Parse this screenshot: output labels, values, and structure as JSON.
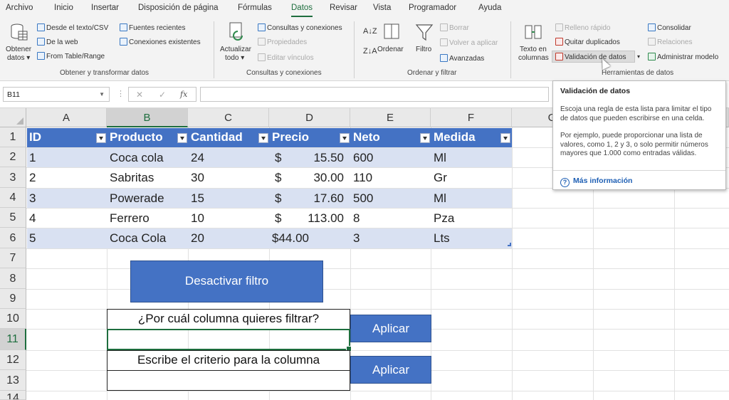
{
  "ribbon_tabs": [
    "Archivo",
    "Inicio",
    "Insertar",
    "Disposición de página",
    "Fórmulas",
    "Datos",
    "Revisar",
    "Vista",
    "Programador",
    "Ayuda"
  ],
  "active_tab": "Datos",
  "groups": {
    "obtener": {
      "label": "Obtener y transformar datos",
      "big_button_line1": "Obtener",
      "big_button_line2": "datos ▾",
      "items": [
        "Desde el texto/CSV",
        "De la web",
        "From Table/Range",
        "Fuentes recientes",
        "Conexiones existentes"
      ]
    },
    "consultas": {
      "label": "Consultas y conexiones",
      "big_button_line1": "Actualizar",
      "big_button_line2": "todo ▾",
      "items": [
        "Consultas y conexiones",
        "Propiedades",
        "Editar vínculos"
      ]
    },
    "ordenar": {
      "label": "Ordenar y filtrar",
      "sort_az": "A↓Z",
      "sort_za": "Z↓A",
      "ordenar": "Ordenar",
      "filtro": "Filtro",
      "borrar": "Borrar",
      "volver": "Volver a aplicar",
      "avanzadas": "Avanzadas"
    },
    "herramientas": {
      "label": "Herramientas de datos",
      "texto_line1": "Texto en",
      "texto_line2": "columnas",
      "items": [
        "Relleno rápido",
        "Quitar duplicados",
        "Validación de datos",
        "Consolidar",
        "Relaciones",
        "Administrar modelo"
      ]
    }
  },
  "formula_bar": {
    "name_box": "B11",
    "cancel": "✕",
    "enter": "✓",
    "fx": "fx",
    "value": ""
  },
  "columns": [
    "A",
    "B",
    "C",
    "D",
    "E",
    "F",
    "G"
  ],
  "rows": [
    "1",
    "2",
    "3",
    "4",
    "5",
    "6",
    "7",
    "8",
    "9",
    "10",
    "11",
    "12",
    "13",
    "14"
  ],
  "table": {
    "headers": [
      "ID",
      "Producto",
      "Cantidad",
      "Precio",
      "Neto",
      "Medida"
    ],
    "rows": [
      [
        "1",
        "Coca cola",
        "24",
        "$",
        "15.50",
        "600",
        "Ml"
      ],
      [
        "2",
        "Sabritas",
        "30",
        "$",
        "30.00",
        "110",
        "Gr"
      ],
      [
        "3",
        "Powerade",
        "15",
        "$",
        "17.60",
        "500",
        "Ml"
      ],
      [
        "4",
        "Ferrero",
        "10",
        "$",
        "113.00",
        "8",
        "Pza"
      ],
      [
        "5",
        "Coca Cola",
        "20",
        "$44.00",
        "",
        "3",
        "Lts"
      ]
    ]
  },
  "shapes": {
    "desactivar": "Desactivar filtro",
    "pregunta": "¿Por cuál columna quieres filtrar?",
    "criterio": "Escribe el criterio para la columna",
    "aplicar1": "Aplicar",
    "aplicar2": "Aplicar"
  },
  "tooltip": {
    "title": "Validación de datos",
    "p1": "Escoja una regla de esta lista para limitar el tipo de datos que pueden escribirse en una celda.",
    "p2": "Por ejemplo, puede proporcionar una lista de valores, como 1, 2 y 3, o solo permitir números mayores que 1.000 como entradas válidas.",
    "link": "Más información"
  },
  "colors": {
    "accent": "#1e6e3e",
    "table_header": "#4472c4",
    "table_band": "#d9e1f2",
    "button": "#4472c4"
  }
}
